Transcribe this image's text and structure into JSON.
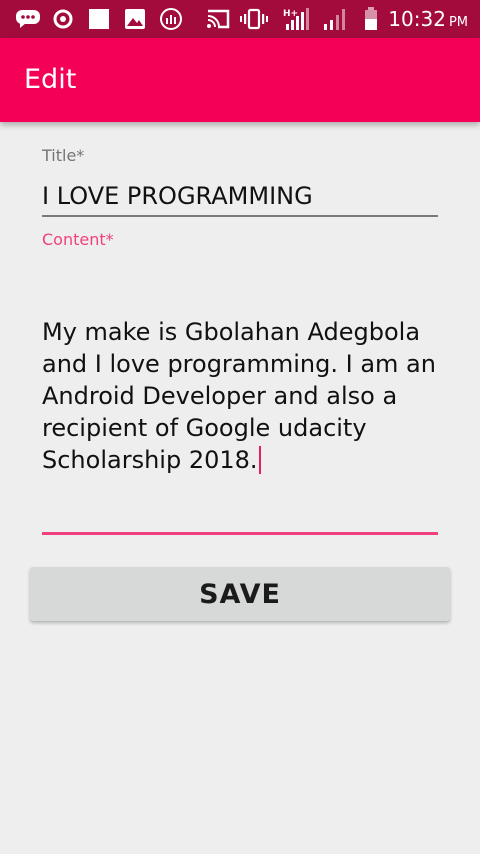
{
  "status_bar": {
    "time": "10:32",
    "ampm": "PM",
    "icons": [
      "chat-icon",
      "record-icon",
      "white-square-icon",
      "image-icon",
      "data-saver-icon",
      "cast-icon",
      "vibrate-icon",
      "signal-h-plus-icon",
      "signal-bars-icon",
      "battery-icon"
    ]
  },
  "app_bar": {
    "title": "Edit",
    "color": "#f50057"
  },
  "form": {
    "title_label": "Title*",
    "title_value": "I LOVE PROGRAMMING",
    "content_label": "Content*",
    "content_value": "My make is Gbolahan Adegbola and I love programming. I am an Android Developer and also a recipient of Google udacity Scholarship 2018.",
    "save_label": "SAVE"
  },
  "colors": {
    "status_bar": "#a30b3d",
    "accent": "#f0407f",
    "background": "#eeeeee",
    "button": "#d7d8d8"
  }
}
